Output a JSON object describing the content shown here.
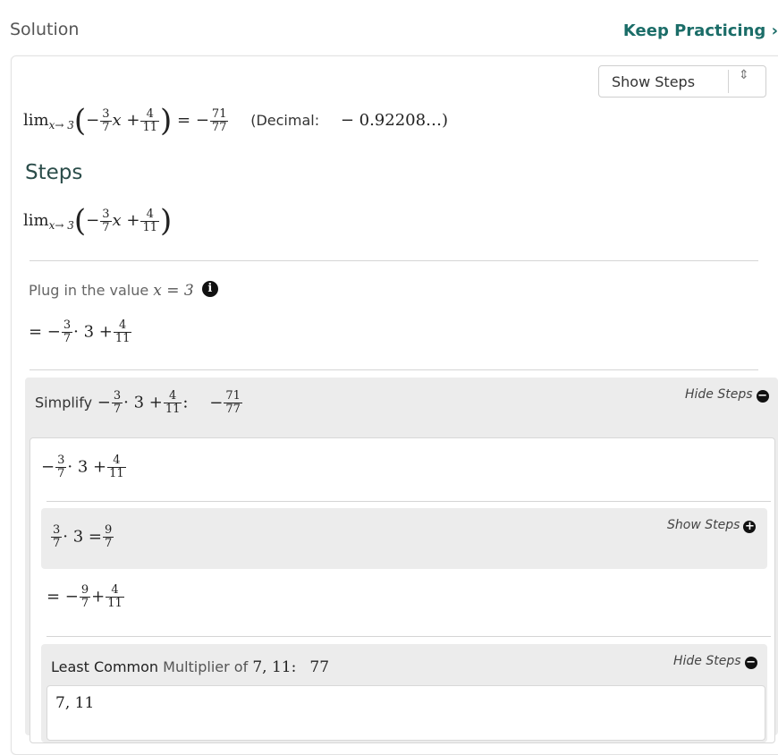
{
  "header": {
    "title": "Solution",
    "keep_practicing": "Keep Practicing ›"
  },
  "select": {
    "value": "Show Steps",
    "arrow": "⇕"
  },
  "result": {
    "lim": "lim",
    "lim_sub": "x→ 3",
    "minus": "−",
    "frac1_n": "3",
    "frac1_d": "7",
    "x_plus": "x +",
    "frac2_n": "4",
    "frac2_d": "11",
    "equals_minus": "= −",
    "ans_n": "71",
    "ans_d": "77",
    "decimal_label": "(Decimal:",
    "decimal_value": "− 0.92208…)"
  },
  "steps": {
    "heading": "Steps",
    "plug_label": "Plug in the value",
    "plug_expr": "x = 3",
    "info_icon": "i",
    "after_plug": "= −",
    "dot3_plus": "· 3 +",
    "step2_eq": "= −",
    "step2_plus": "+"
  },
  "simplify_panel": {
    "label": "Simplify",
    "colon": ":",
    "toggle": "Hide Steps",
    "toggle_icon": "−"
  },
  "mult_panel": {
    "eq": "· 3 =",
    "toggle": "Show Steps",
    "toggle_icon": "+"
  },
  "lcm_panel": {
    "label_a": "Least Common",
    "label_b": "Multiplier of",
    "numbers": "7, 11:",
    "value": "77",
    "toggle": "Hide Steps",
    "toggle_icon": "−",
    "inner_text": "7, 11"
  },
  "colors": {
    "accent": "#1b6d68",
    "panel_bg": "#ececec"
  }
}
